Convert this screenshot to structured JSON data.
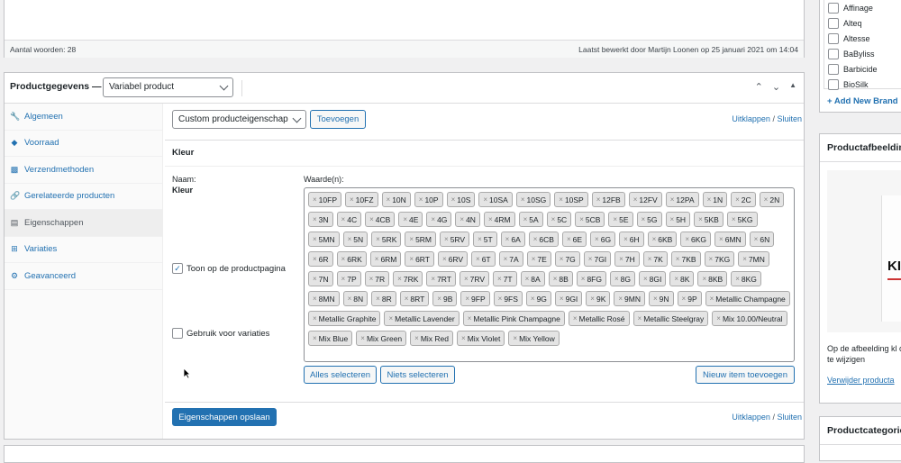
{
  "editor": {
    "word_count": "Aantal woorden: 28",
    "last_edited": "Laatst bewerkt door Martijn Loonen op 25 januari 2021 om 14:04"
  },
  "product_data": {
    "title": "Productgegevens —",
    "type_select": "Variabel product",
    "tabs": [
      {
        "label": "Algemeen",
        "icon": "wrench-icon"
      },
      {
        "label": "Voorraad",
        "icon": "tag-icon"
      },
      {
        "label": "Verzendmethoden",
        "icon": "truck-icon"
      },
      {
        "label": "Gerelateerde producten",
        "icon": "link-icon"
      },
      {
        "label": "Eigenschappen",
        "icon": "list-icon"
      },
      {
        "label": "Variaties",
        "icon": "grid-icon"
      },
      {
        "label": "Geavanceerd",
        "icon": "gear-icon"
      }
    ],
    "active_tab": "Eigenschappen",
    "attributes": {
      "select_value": "Custom producteigenschap",
      "add_button": "Toevoegen",
      "expand_link": "Uitklappen",
      "separator": "/",
      "collapse_link": "Sluiten",
      "attribute_title": "Kleur",
      "name_label": "Naam:",
      "name_value": "Kleur",
      "values_label": "Waarde(n):",
      "show_on_page_label": "Toon op de productpagina",
      "show_on_page_checked": true,
      "use_for_variations_label": "Gebruik voor variaties",
      "use_for_variations_checked": false,
      "select_all": "Alles selecteren",
      "select_none": "Niets selecteren",
      "add_new": "Nieuw item toevoegen",
      "save_button": "Eigenschappen opslaan",
      "values": [
        "10FP",
        "10FZ",
        "10N",
        "10P",
        "10S",
        "10SA",
        "10SG",
        "10SP",
        "12FB",
        "12FV",
        "12PA",
        "1N",
        "2C",
        "2N",
        "3N",
        "4C",
        "4CB",
        "4E",
        "4G",
        "4N",
        "4RM",
        "5A",
        "5C",
        "5CB",
        "5E",
        "5G",
        "5H",
        "5KB",
        "5KG",
        "5MN",
        "5N",
        "5RK",
        "5RM",
        "5RV",
        "5T",
        "6A",
        "6CB",
        "6E",
        "6G",
        "6H",
        "6KB",
        "6KG",
        "6MN",
        "6N",
        "6R",
        "6RK",
        "6RM",
        "6RT",
        "6RV",
        "6T",
        "7A",
        "7E",
        "7G",
        "7GI",
        "7H",
        "7K",
        "7KB",
        "7KG",
        "7MN",
        "7N",
        "7P",
        "7R",
        "7RK",
        "7RT",
        "7RV",
        "7T",
        "8A",
        "8B",
        "8FG",
        "8G",
        "8GI",
        "8K",
        "8KB",
        "8KG",
        "8MN",
        "8N",
        "8R",
        "8RT",
        "9B",
        "9FP",
        "9FS",
        "9G",
        "9GI",
        "9K",
        "9MN",
        "9N",
        "9P",
        "Metallic Champagne",
        "Metallic Graphite",
        "Metallic Lavender",
        "Metallic Pink Champagne",
        "Metallic Rosé",
        "Metallic Steelgray",
        "Mix 10.00/Neutral",
        "Mix Blue",
        "Mix Green",
        "Mix Red",
        "Mix Violet",
        "Mix Yellow"
      ]
    }
  },
  "sidebar": {
    "brands": [
      "Affinage",
      "Alteq",
      "Altesse",
      "BaByliss",
      "Barbicide",
      "BioSilk"
    ],
    "add_brand": "+ Add New Brand",
    "image_title": "Productafbeelding",
    "image_hint": "Op de afbeelding kl of te wijzigen",
    "image_remove": "Verwijder producta",
    "image_label": "KIS",
    "categories_title": "Productcategorie"
  }
}
